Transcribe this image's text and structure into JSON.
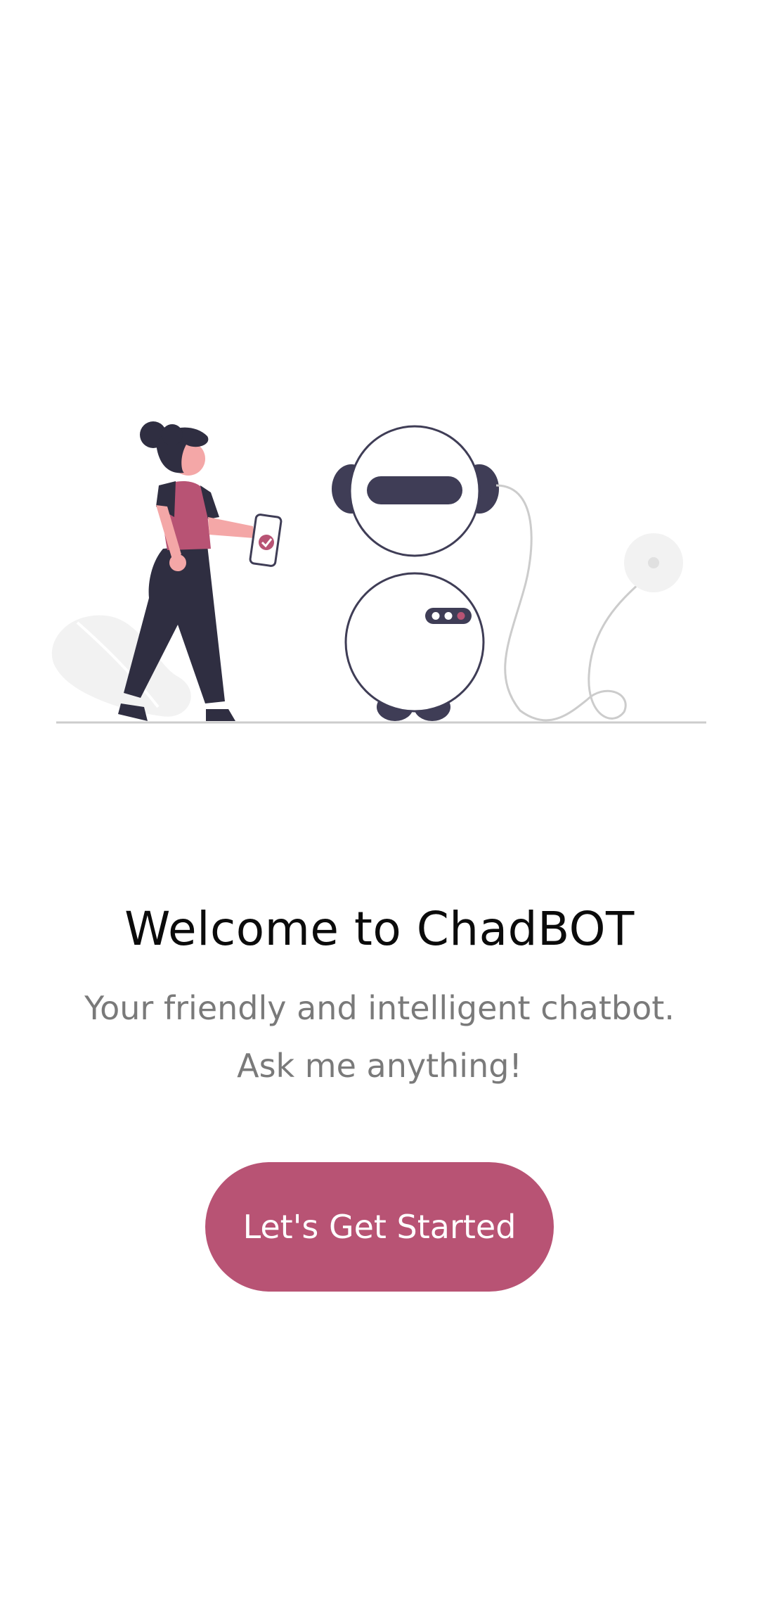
{
  "welcome": {
    "title": "Welcome to ChadBOT",
    "subtitle": "Your friendly and intelligent chatbot. Ask me anything!",
    "cta_label": "Let's Get Started"
  },
  "illustration": {
    "subject": "woman-with-phone-and-robot-icon",
    "colors": {
      "accent": "#b85374",
      "dark": "#3f3d56",
      "skin": "#f4a7a7",
      "light_gray": "#f2f2f2",
      "line_gray": "#cccccc"
    }
  },
  "theme": {
    "background": "#ffffff",
    "primary": "#b85374",
    "title_color": "#0b0b0b",
    "subtitle_color": "#7a7a7a"
  }
}
